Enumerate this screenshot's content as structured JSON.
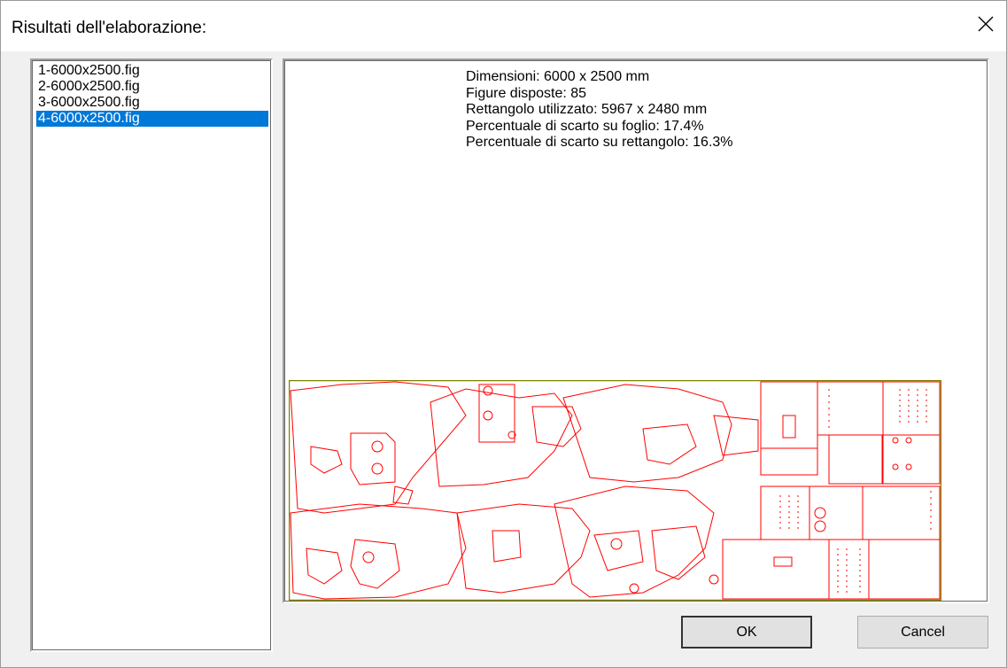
{
  "window": {
    "title": "Risultati dell'elaborazione:",
    "close_icon": "close-icon"
  },
  "file_list": {
    "items": [
      {
        "label": "1-6000x2500.fig",
        "selected": false
      },
      {
        "label": "2-6000x2500.fig",
        "selected": false
      },
      {
        "label": "3-6000x2500.fig",
        "selected": false
      },
      {
        "label": "4-6000x2500.fig",
        "selected": true
      }
    ],
    "selection_color": "#0078d7"
  },
  "preview": {
    "info": {
      "dimensions": "Dimensioni: 6000 x 2500 mm",
      "figures": "Figure disposte: 85",
      "rectangle": "Rettangolo utilizzato: 5967 x 2480 mm",
      "waste_sheet": "Percentuale di scarto su foglio: 17.4%",
      "waste_rect": "Percentuale di scarto su rettangolo: 16.3%"
    },
    "sheet_border_color": "#808000",
    "parts_color": "#ff0000"
  },
  "buttons": {
    "ok_label": "OK",
    "cancel_label": "Cancel"
  }
}
